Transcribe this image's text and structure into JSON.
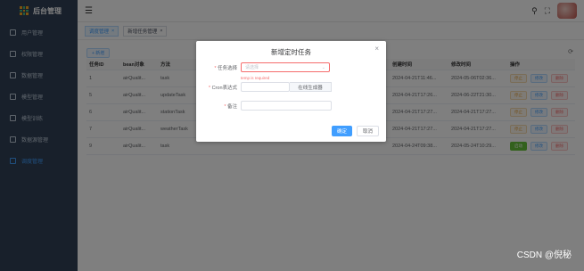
{
  "sidebar": {
    "app_title": "后台管理",
    "items": [
      {
        "label": "用户管理",
        "icon": "user-icon"
      },
      {
        "label": "权限管理",
        "icon": "document-icon"
      },
      {
        "label": "数据管理",
        "icon": "data-icon"
      },
      {
        "label": "模型管理",
        "icon": "model-icon"
      },
      {
        "label": "模型训练",
        "icon": "training-icon"
      },
      {
        "label": "数据源管理",
        "icon": "datasource-icon"
      },
      {
        "label": "调度管理",
        "icon": "schedule-icon"
      }
    ]
  },
  "tags": [
    {
      "label": "调度管理",
      "active": true
    },
    {
      "label": "新增任务管理",
      "active": false
    }
  ],
  "toolbar": {
    "add_label": "+ 新增"
  },
  "table": {
    "headers": [
      "任务ID",
      "bean对象",
      "方法",
      "",
      "创建时间",
      "修改时间",
      "操作"
    ],
    "rows": [
      {
        "id": "1",
        "bean": "airQualit...",
        "method": "task",
        "created": "2024-04-21T11:46...",
        "updated": "2024-05-06T02:36...",
        "toggle": "停止"
      },
      {
        "id": "5",
        "bean": "airQualit...",
        "method": "updateTask",
        "created": "2024-04-21T17:26...",
        "updated": "2024-06-22T21:30...",
        "toggle": "停止"
      },
      {
        "id": "6",
        "bean": "airQualit...",
        "method": "stationTask",
        "created": "2024-04-21T17:27...",
        "updated": "2024-04-21T17:27...",
        "toggle": "停止"
      },
      {
        "id": "7",
        "bean": "airQualit...",
        "method": "weatherTask",
        "created": "2024-04-21T17:27...",
        "updated": "2024-04-21T17:27...",
        "toggle": "停止"
      },
      {
        "id": "9",
        "bean": "airQualit...",
        "method": "task",
        "created": "2024-04-24T09:38...",
        "updated": "2024-05-24T10:29...",
        "toggle": "启动"
      }
    ],
    "edit_label": "修改",
    "delete_label": "删除"
  },
  "dialog": {
    "title": "新增定时任务",
    "task_label": "任务选择",
    "task_placeholder": "请选择",
    "task_error": "temp is required",
    "cron_label": "Cron表达式",
    "cron_button": "在线生成器",
    "remark_label": "备注",
    "confirm_label": "确定",
    "cancel_label": "取消"
  },
  "watermark": "CSDN @倪秘"
}
